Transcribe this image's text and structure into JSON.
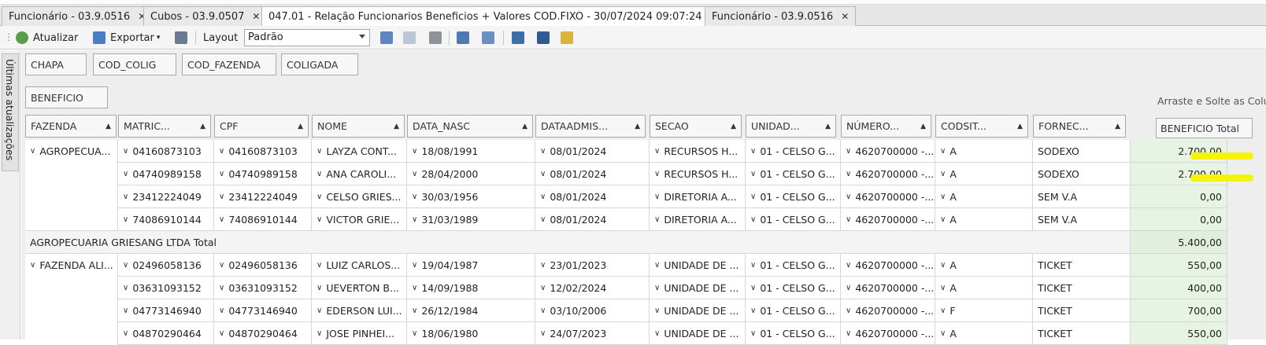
{
  "tabs": [
    {
      "label": "Funcionário - 03.9.0516"
    },
    {
      "label": "Cubos - 03.9.0507"
    },
    {
      "label": "047.01 - Relação Funcionarios Beneficios + Valores COD.FIXO - 30/07/2024 09:07:24"
    },
    {
      "label": "Funcionário - 03.9.0516"
    }
  ],
  "toolbar": {
    "refresh_label": "Atualizar",
    "export_label": "Exportar",
    "layout_label": "Layout",
    "layout_value": "Padrão"
  },
  "side_tab_label": "Últimas atualizações",
  "filter_fields": [
    "CHAPA",
    "COD_COLIG",
    "COD_FAZENDA",
    "COLIGADA"
  ],
  "data_field": "BENEFICIO",
  "drop_hint": "Arraste e Solte as Colu",
  "value_header": "BENEFICIO Total",
  "columns": [
    "FAZENDA",
    "MATRIC...",
    "CPF",
    "NOME",
    "DATA_NASC",
    "DATAADMIS...",
    "SECAO",
    "UNIDAD...",
    "NÚMERO...",
    "CODSIT...",
    "FORNEC..."
  ],
  "rows": [
    {
      "fazenda": "AGROPECUA...",
      "matric": "04160873103",
      "cpf": "04160873103",
      "nome": "LAYZA CONT...",
      "data_nasc": "18/08/1991",
      "dataadmis": "08/01/2024",
      "secao": "RECURSOS H...",
      "unidade": "01 - CELSO G...",
      "numero": "4620700000 -...",
      "codsit": "A",
      "fornec": "SODEXO",
      "total": "2.700,00"
    },
    {
      "fazenda": "",
      "matric": "04740989158",
      "cpf": "04740989158",
      "nome": "ANA CAROLI...",
      "data_nasc": "28/04/2000",
      "dataadmis": "08/01/2024",
      "secao": "RECURSOS H...",
      "unidade": "01 - CELSO G...",
      "numero": "4620700000 -...",
      "codsit": "A",
      "fornec": "SODEXO",
      "total": "2.700,00"
    },
    {
      "fazenda": "",
      "matric": "23412224049",
      "cpf": "23412224049",
      "nome": "CELSO GRIES...",
      "data_nasc": "30/03/1956",
      "dataadmis": "08/01/2024",
      "secao": "DIRETORIA A...",
      "unidade": "01 - CELSO G...",
      "numero": "4620700000 -...",
      "codsit": "A",
      "fornec": "SEM V.A",
      "total": "0,00"
    },
    {
      "fazenda": "",
      "matric": "74086910144",
      "cpf": "74086910144",
      "nome": "VICTOR GRIE...",
      "data_nasc": "31/03/1989",
      "dataadmis": "08/01/2024",
      "secao": "DIRETORIA A...",
      "unidade": "01 - CELSO G...",
      "numero": "4620700000 -...",
      "codsit": "A",
      "fornec": "SEM V.A",
      "total": "0,00"
    },
    {
      "subtotal_label": "AGROPECUARIA GRIESANG LTDA Total",
      "total": "5.400,00"
    },
    {
      "fazenda": "FAZENDA ALI...",
      "matric": "02496058136",
      "cpf": "02496058136",
      "nome": "LUIZ CARLOS...",
      "data_nasc": "19/04/1987",
      "dataadmis": "23/01/2023",
      "secao": "UNIDADE DE ...",
      "unidade": "01 - CELSO G...",
      "numero": "4620700000 -...",
      "codsit": "A",
      "fornec": "TICKET",
      "total": "550,00"
    },
    {
      "fazenda": "",
      "matric": "03631093152",
      "cpf": "03631093152",
      "nome": "UEVERTON B...",
      "data_nasc": "14/09/1988",
      "dataadmis": "12/02/2024",
      "secao": "UNIDADE DE ...",
      "unidade": "01 - CELSO G...",
      "numero": "4620700000 -...",
      "codsit": "A",
      "fornec": "TICKET",
      "total": "400,00"
    },
    {
      "fazenda": "",
      "matric": "04773146940",
      "cpf": "04773146940",
      "nome": "EDERSON LUI...",
      "data_nasc": "26/12/1984",
      "dataadmis": "03/10/2006",
      "secao": "UNIDADE DE ...",
      "unidade": "01 - CELSO G...",
      "numero": "4620700000 -...",
      "codsit": "F",
      "fornec": "TICKET",
      "total": "700,00"
    },
    {
      "fazenda": "",
      "matric": "04870290464",
      "cpf": "04870290464",
      "nome": "JOSE PINHEI...",
      "data_nasc": "18/06/1980",
      "dataadmis": "24/07/2023",
      "secao": "UNIDADE DE ...",
      "unidade": "01 - CELSO G...",
      "numero": "4620700000 -...",
      "codsit": "A",
      "fornec": "TICKET",
      "total": "550,00"
    }
  ]
}
